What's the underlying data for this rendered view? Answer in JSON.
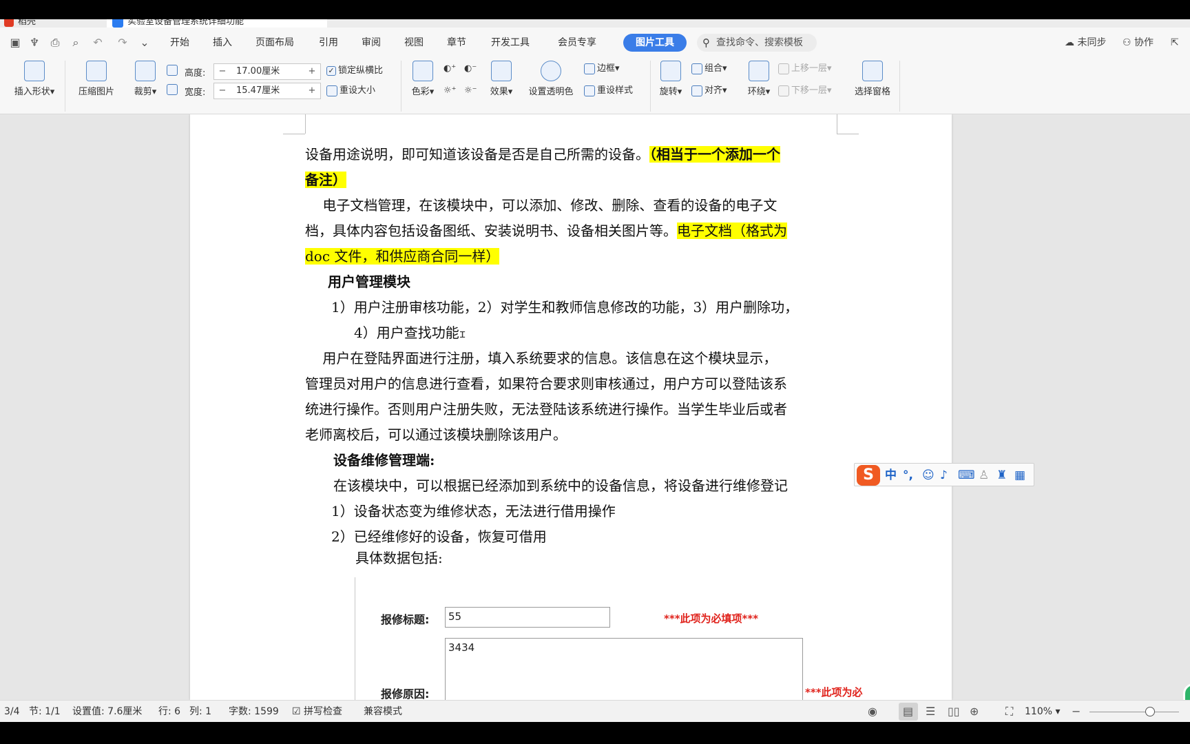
{
  "titlebar": {
    "home_tab": "稻壳",
    "doc_tab": "实验室设备管理系统详细功能"
  },
  "menubar": {
    "items": [
      "开始",
      "插入",
      "页面布局",
      "引用",
      "审阅",
      "视图",
      "章节",
      "开发工具",
      "会员专享"
    ],
    "active": "图片工具",
    "search": "查找命令、搜索模板",
    "unsynced": "未同步",
    "collab": "协作"
  },
  "ribbon": {
    "insert_shape": "插入形状",
    "compress": "压缩图片",
    "crop": "裁剪",
    "height_label": "高度:",
    "height_value": "17.00厘米",
    "width_label": "宽度:",
    "width_value": "15.47厘米",
    "lock_ratio": "锁定纵横比",
    "reset_size": "重设大小",
    "color": "色彩",
    "effects": "效果",
    "transparent": "设置透明色",
    "border": "边框",
    "reset_style": "重设样式",
    "rotate": "旋转",
    "group": "组合",
    "align": "对齐",
    "wrap": "环绕",
    "bring_forward": "上移一层",
    "send_backward": "下移一层",
    "selection_pane": "选择窗格"
  },
  "document": {
    "lines": [
      {
        "pre": "设备用途说明，即可知道该设备是否是自己所需的设备。",
        "hl": "（相当于一个添加一个"
      },
      {
        "hl": "备注）"
      },
      {
        "pre": "    电子文档管理，在该模块中，可以添加、修改、删除、查看的设备的电子文"
      },
      {
        "pre": "档，具体内容包括设备图纸、安装说明书、设备相关图片等。",
        "hl": "电子文档（格式为"
      },
      {
        "hl": "doc 文件，和供应商合同一样）"
      },
      {
        "pre": "用户管理模块"
      },
      {
        "pre": "1）用户注册审核功能，2）对学生和教师信息修改的功能，3）用户删除功，"
      },
      {
        "pre": "4）用户查找功能"
      },
      {
        "pre": "    用户在登陆界面进行注册，填入系统要求的信息。该信息在这个模块显示，"
      },
      {
        "pre": "管理员对用户的信息进行查看，如果符合要求则审核通过，用户方可以登陆该系"
      },
      {
        "pre": "统进行操作。否则用户注册失败，无法登陆该系统进行操作。当学生毕业后或者"
      },
      {
        "pre": "老师离校后，可以通过该模块删除该用户。"
      },
      {
        "pre": "设备维修管理端:"
      },
      {
        "pre": "在该模块中，可以根据已经添加到系统中的设备信息，将设备进行维修登记"
      },
      {
        "pre": "1）设备状态变为维修状态，无法进行借用操作"
      },
      {
        "pre": "2）已经维修好的设备，恢复可借用"
      },
      {
        "pre": "具体数据包括:"
      }
    ],
    "form": {
      "title_label": "报修标题:",
      "title_value": "55",
      "title_required": "***此项为必填项***",
      "reason_label": "报修原因:",
      "reason_value": "3434",
      "reason_required": "***此项为必"
    }
  },
  "ime": {
    "logo": "S",
    "mode": "中"
  },
  "statusbar": {
    "page": "3/4",
    "section": "节: 1/1",
    "setting": "设置值: 7.6厘米",
    "row": "行: 6",
    "col": "列: 1",
    "words": "字数: 1599",
    "spell": "拼写检查",
    "compat": "兼容模式",
    "zoom": "110%"
  },
  "colors": {
    "accent": "#3a7de8",
    "highlight": "#ffff00",
    "required": "#e0231c"
  }
}
